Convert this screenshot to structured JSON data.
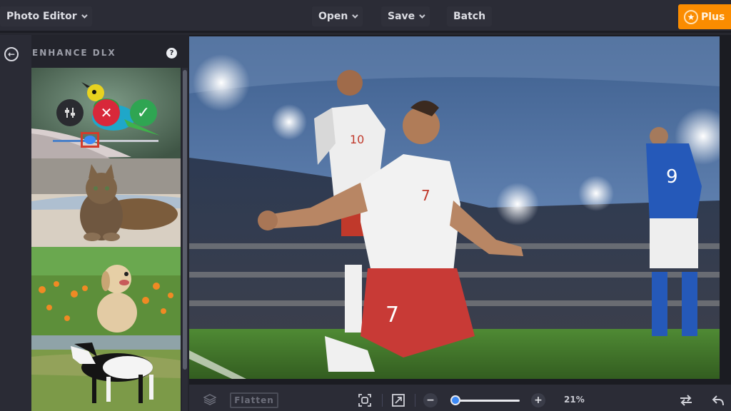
{
  "topbar": {
    "app_menu_label": "Photo Editor",
    "open_label": "Open",
    "save_label": "Save",
    "batch_label": "Batch",
    "plus_label": "Plus",
    "plus_color": "#fb8c00"
  },
  "panel": {
    "title": "ENHANCE DLX",
    "back_icon": "arrow-left-circle-icon",
    "help_icon": "question-icon",
    "help_glyph": "?",
    "back_glyph": "←",
    "thumbnails": [
      {
        "subject": "bird",
        "active": true,
        "controls": {
          "adjust_icon": "sliders-icon",
          "cancel_icon": "x-icon",
          "apply_icon": "check-icon",
          "cancel_glyph": "✕",
          "apply_glyph": "✓",
          "slider_value": 0.35
        }
      },
      {
        "subject": "cat"
      },
      {
        "subject": "puppy"
      },
      {
        "subject": "horse"
      }
    ]
  },
  "canvas": {
    "subject": "soccer players celebrating in stadium",
    "jersey_numbers": [
      "10",
      "7",
      "9"
    ]
  },
  "bottombar": {
    "layers_icon": "layers-icon",
    "flatten_label": "Flatten",
    "fit_icon": "fit-screen-icon",
    "expand_icon": "expand-icon",
    "zoom_out_glyph": "−",
    "zoom_in_glyph": "+",
    "zoom_level": 0.21,
    "zoom_label": "21%",
    "compare_icon": "swap-icon",
    "undo_icon": "undo-icon"
  }
}
